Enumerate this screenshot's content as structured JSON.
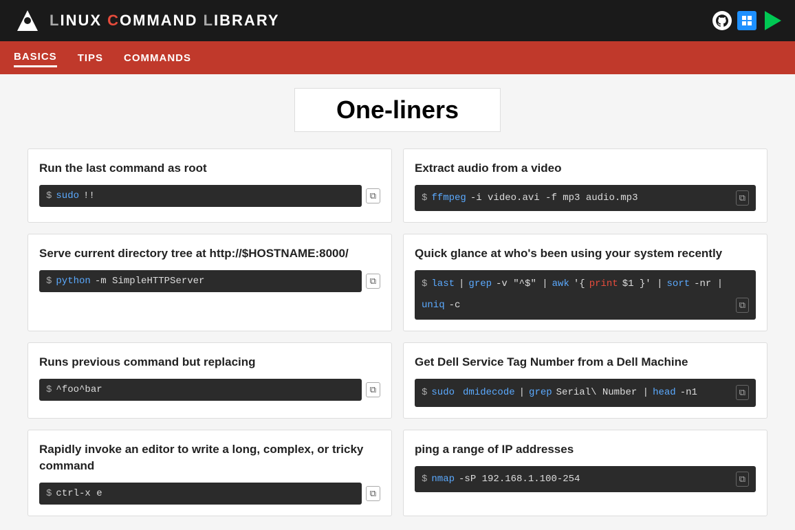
{
  "header": {
    "title_l1": "L",
    "title_w1": "INUX",
    "title_c": "C",
    "title_w2": "OMMAND",
    "title_l2": "L",
    "title_w3": "IBRARY"
  },
  "nav": {
    "items": [
      {
        "label": "BASICS",
        "active": true
      },
      {
        "label": "TIPS",
        "active": false
      },
      {
        "label": "COMMANDS",
        "active": false
      }
    ]
  },
  "page": {
    "title": "One-liners"
  },
  "cards": [
    {
      "id": "card1",
      "title": "Run the last command as root",
      "command": {
        "dollar": "$",
        "parts": [
          {
            "text": "sudo",
            "type": "keyword"
          },
          {
            "text": " !!",
            "type": "normal"
          }
        ]
      }
    },
    {
      "id": "card2",
      "title": "Extract audio from a video",
      "command": {
        "dollar": "$",
        "parts": [
          {
            "text": "ffmpeg",
            "type": "keyword"
          },
          {
            "text": " -i video.avi -f mp3 audio.mp3",
            "type": "normal"
          }
        ]
      }
    },
    {
      "id": "card3",
      "title": "Serve current directory tree at http://$HOSTNAME:8000/",
      "command": {
        "dollar": "$",
        "parts": [
          {
            "text": "python",
            "type": "keyword"
          },
          {
            "text": " -m SimpleHTTPServer",
            "type": "normal"
          }
        ]
      }
    },
    {
      "id": "card4",
      "title": "Quick glance at who's been using your system recently",
      "command": {
        "dollar": "$",
        "parts": [
          {
            "text": "last",
            "type": "keyword"
          },
          {
            "text": "  |  ",
            "type": "normal"
          },
          {
            "text": "grep",
            "type": "keyword"
          },
          {
            "text": " -v \"^$\"  |  ",
            "type": "normal"
          },
          {
            "text": "awk",
            "type": "keyword"
          },
          {
            "text": " '{ ",
            "type": "normal"
          },
          {
            "text": "print",
            "type": "print"
          },
          {
            "text": " $1 }'  |  ",
            "type": "normal"
          },
          {
            "text": "sort",
            "type": "keyword"
          },
          {
            "text": " -nr |",
            "type": "normal"
          },
          {
            "text": "\nuniq",
            "type": "keyword"
          },
          {
            "text": " -c",
            "type": "normal"
          }
        ]
      }
    },
    {
      "id": "card5",
      "title": "Runs previous command but replacing",
      "command": {
        "dollar": "$",
        "parts": [
          {
            "text": " ^foo^bar",
            "type": "normal"
          }
        ]
      }
    },
    {
      "id": "card6",
      "title": "Get Dell Service Tag Number from a Dell Machine",
      "command": {
        "dollar": "$",
        "parts": [
          {
            "text": "sudo",
            "type": "keyword"
          },
          {
            "text": " ",
            "type": "normal"
          },
          {
            "text": "dmidecode",
            "type": "keyword"
          },
          {
            "text": " |  ",
            "type": "normal"
          },
          {
            "text": "grep",
            "type": "keyword"
          },
          {
            "text": " Serial\\ Number  |  ",
            "type": "normal"
          },
          {
            "text": "head",
            "type": "keyword"
          },
          {
            "text": " -n1",
            "type": "normal"
          }
        ]
      }
    },
    {
      "id": "card7",
      "title": "Rapidly invoke an editor to write a long, complex, or tricky command",
      "command": {
        "dollar": "$",
        "parts": [
          {
            "text": "ctrl-x e",
            "type": "normal"
          }
        ]
      }
    },
    {
      "id": "card8",
      "title": "ping a range of IP addresses",
      "command": {
        "dollar": "$",
        "parts": [
          {
            "text": "nmap",
            "type": "keyword"
          },
          {
            "text": " -sP 192.168.1.100-254",
            "type": "normal"
          }
        ]
      }
    }
  ],
  "labels": {
    "copy": "⧉",
    "copy_unicode": "⧉"
  }
}
